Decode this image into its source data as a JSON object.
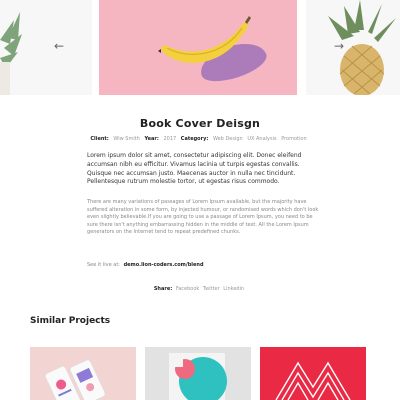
{
  "slider": {
    "prev_icon": "arrow-left-icon",
    "next_icon": "arrow-right-icon",
    "prev_glyph": "←",
    "next_glyph": "→",
    "center_bg": "#f6b6c1",
    "side_bg": "#f7f7f7"
  },
  "project": {
    "title": "Book Cover Deisgn",
    "client_label": "Client:",
    "client_value": "Wiw Smith",
    "year_label": "Year:",
    "year_value": "2017",
    "category_label": "Category:",
    "categories": [
      "Web Design",
      "UX Analysis",
      "Promotion"
    ]
  },
  "content": {
    "lead": "Lorem ipsum dolor sit amet, consectetur adipiscing elit. Donec eleifend accumsan nibh eu efficitur. Vivamus lacinia ut turpis egestas convallis. Quisque nec accumsan justo. Maecenas auctor in nulla nec tincidunt. Pellentesque rutrum molestie tortor, ut egestas risus commodo.",
    "body": "There are many variations of passages of Lorem Ipsum available, but the majority have suffered alteration in some form, by injected humour, or randomised words which don't look even slightly believable.If you are going to use a passage of Lorem Ipsum, you need to be sure there isn't anything embarrassing hidden in the middle of text. All the Lorem Ipsum generators on the Internet tend to repeat predefined chunks.",
    "live_label": "See it live at:",
    "live_link": "demo.lion-coders.com/blend"
  },
  "share": {
    "label": "Share:",
    "links": [
      "Facebook",
      "Twitter",
      "Linkedin"
    ]
  },
  "similar": {
    "heading": "Similar Projects"
  },
  "colors": {
    "accent_red": "#ea2a45",
    "banana": "#f4d03f",
    "teal": "#2fc1c0"
  }
}
